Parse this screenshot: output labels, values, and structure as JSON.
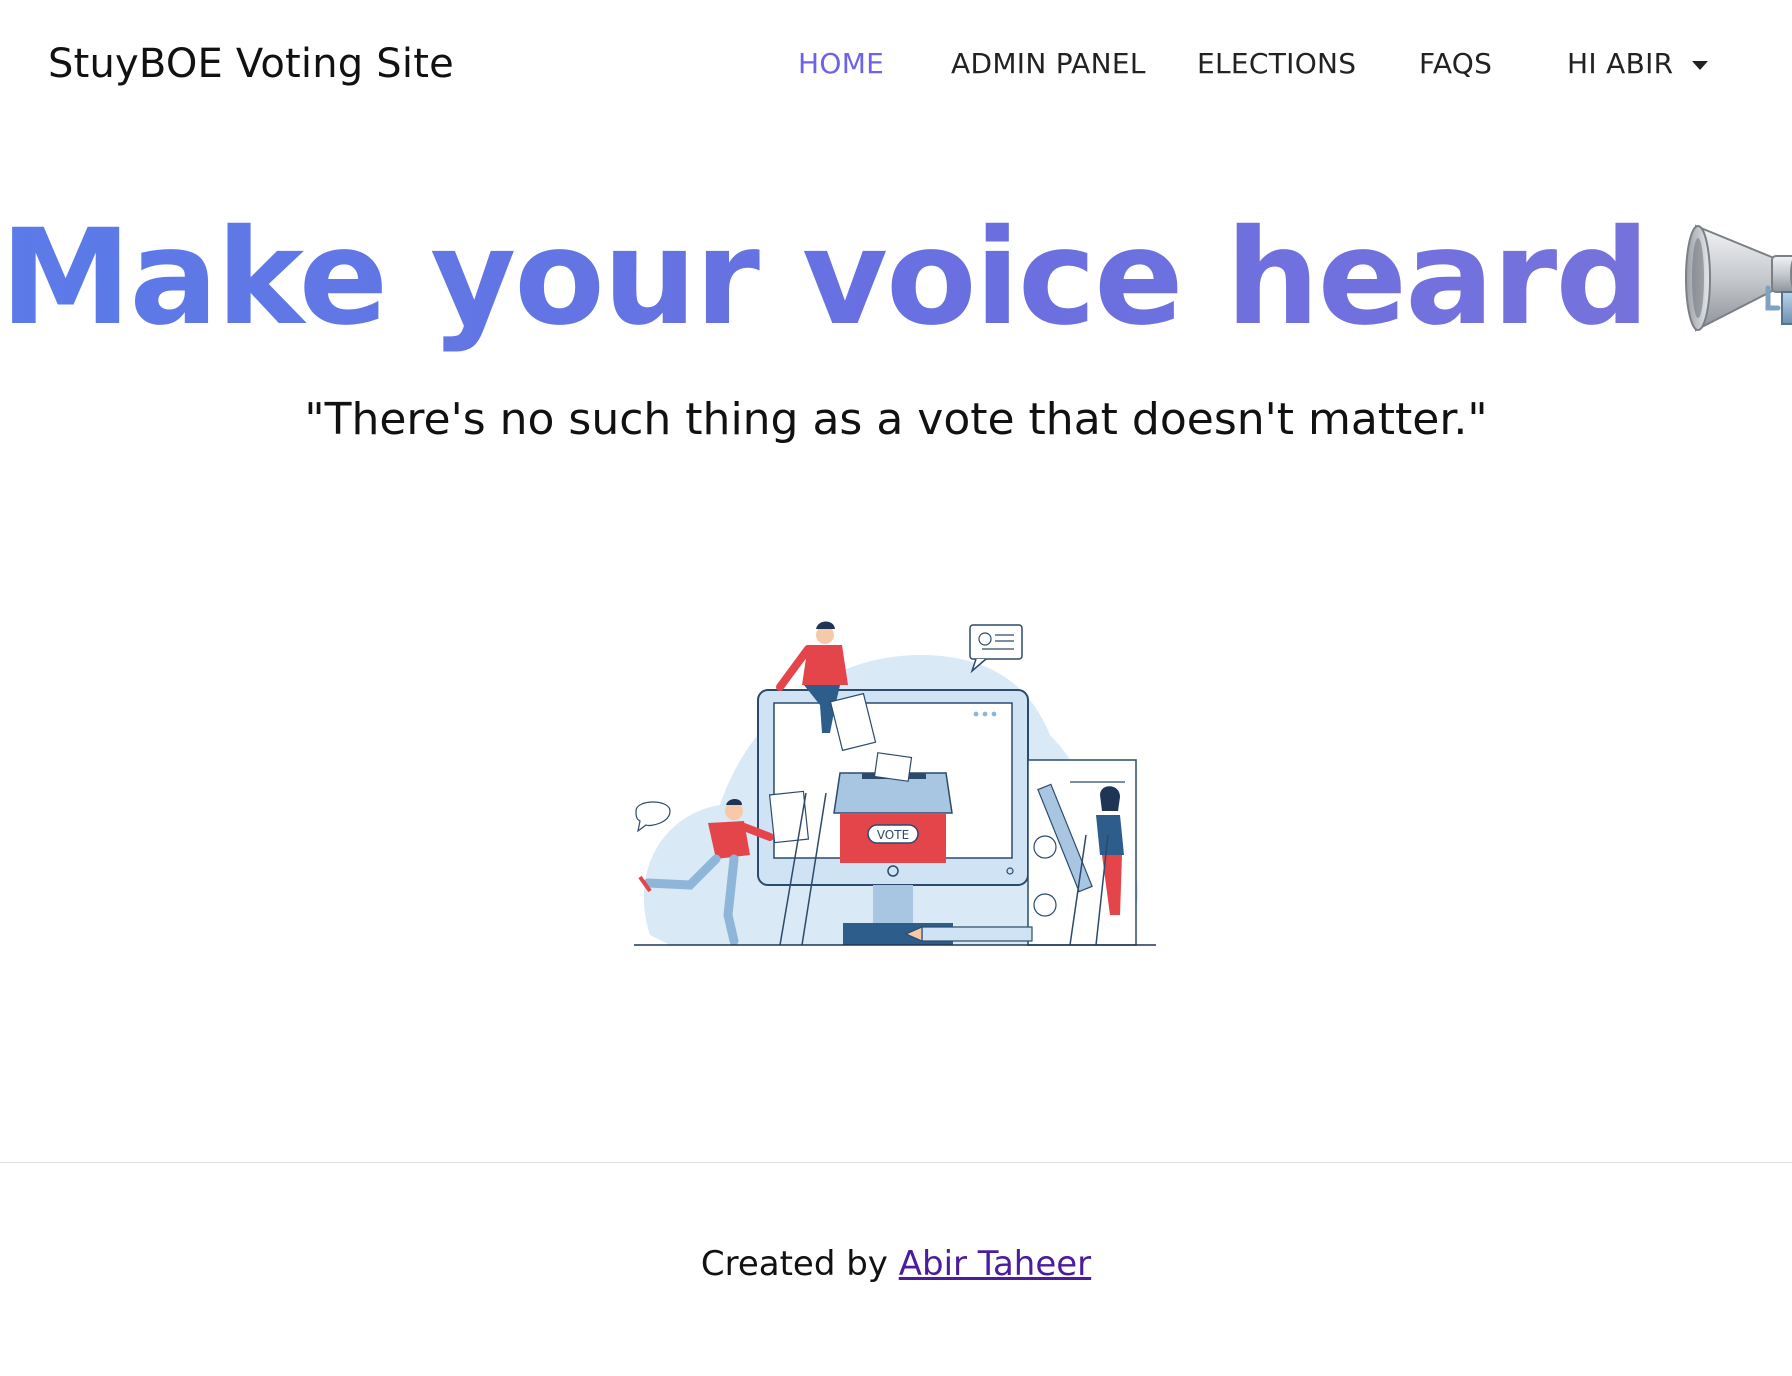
{
  "navbar": {
    "brand": "StuyBOE Voting Site",
    "items": [
      {
        "label": "HOME",
        "active": true
      },
      {
        "label": "ADMIN PANEL",
        "active": false
      },
      {
        "label": "ELECTIONS",
        "active": false
      },
      {
        "label": "FAQS",
        "active": false
      },
      {
        "label": "HI ABIR",
        "active": false
      }
    ],
    "user_menu_icon": "chevron-down-icon"
  },
  "hero": {
    "title": "Make your voice heard",
    "title_icon": "megaphone-icon",
    "quote": "\"There's no such thing as a vote that doesn't matter.\"",
    "illustration_label": "VOTE"
  },
  "footer": {
    "prefix": "Created by",
    "author_link": "Abir Taheer"
  },
  "colors": {
    "accent": "#6c63e6",
    "title_gradient_start": "#5b7be8",
    "title_gradient_end": "#7672dc",
    "illustration_red": "#e4454a",
    "illustration_blue": "#d6e8f6",
    "footer_link": "#4b1c9e"
  }
}
